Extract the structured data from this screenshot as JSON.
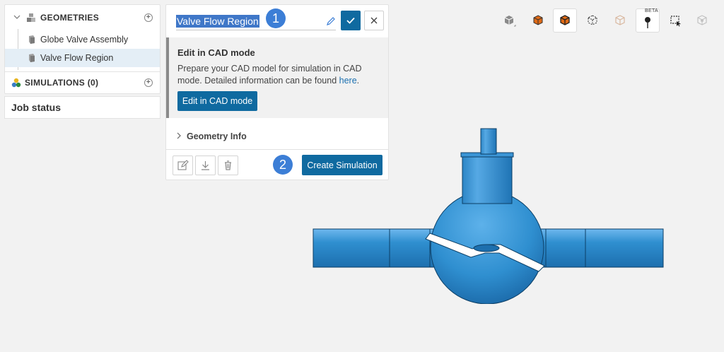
{
  "tree": {
    "geometries_label": "GEOMETRIES",
    "items": [
      {
        "label": "Globe Valve Assembly"
      },
      {
        "label": "Valve Flow Region"
      }
    ],
    "simulations_label": "SIMULATIONS (0)"
  },
  "job_status_label": "Job status",
  "properties": {
    "name_value": "Valve Flow Region",
    "cad_title": "Edit in CAD mode",
    "cad_text": "Prepare your CAD model for simulation in CAD mode. Detailed information can be found ",
    "cad_link": "here",
    "cad_text_end": ".",
    "cad_button": "Edit in CAD mode",
    "geometry_info": "Geometry Info",
    "create_simulation": "Create Simulation"
  },
  "badges": {
    "one": "1",
    "two": "2"
  },
  "toolbar": {
    "beta_label": "BETA"
  },
  "colors": {
    "accent": "#0f6aa0",
    "badge": "#3c7ed6",
    "selection": "#3f77c8",
    "model": "#2f8fd0"
  },
  "icons": [
    "chevron-down-icon",
    "geometry-stack-icon",
    "plus-icon",
    "part-icon",
    "simulation-icon",
    "pencil-icon",
    "check-icon",
    "close-icon",
    "chevron-right-icon",
    "edit-icon",
    "download-icon",
    "trash-icon",
    "view-cube-icon",
    "solid-view-icon",
    "solid-edges-icon",
    "wireframe-icon",
    "transparent-icon",
    "probe-icon",
    "box-select-icon",
    "hidden-icon"
  ]
}
